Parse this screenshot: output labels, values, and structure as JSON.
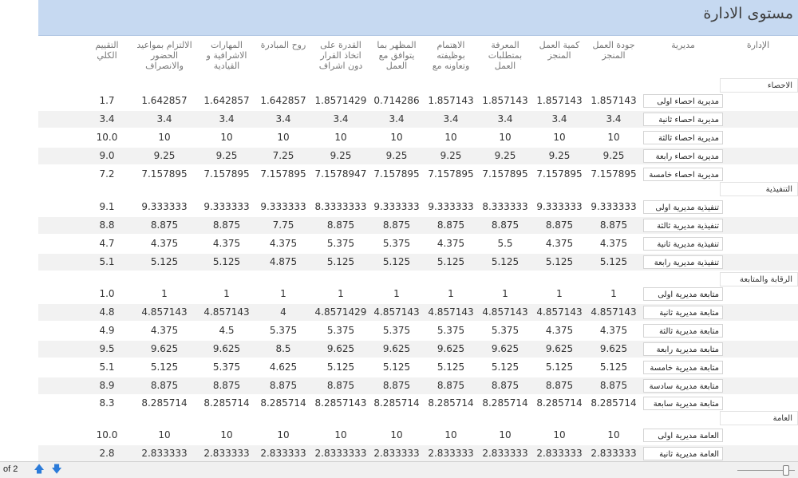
{
  "report": {
    "title": "مستوى الادارة",
    "headers": {
      "admin": "الإدارة",
      "directorate": "مديرية",
      "c1": "جودة العمل المنجز",
      "c2": "كمية العمل المنجز",
      "c3": "المعرفة بمتطلبات العمل",
      "c4": "الاهتمام بوظيفته وتعاونه مع",
      "c5": "المظهر بما يتوافق مع العمل",
      "c6": "القدرة على اتخاذ القرار دون اشراف",
      "c7": "روح المبادرة",
      "c8": "المهارات الاشرافية و القيادية",
      "c9": "الالتزام بمواعيد الحضور والانصراف",
      "c10": "التقييم الكلي"
    },
    "groups": [
      {
        "label": "الاحصاء",
        "rows": [
          {
            "name": "مديرية احصاء اولى",
            "vals": [
              "1.857143",
              "1.857143",
              "1.857143",
              "1.857143",
              "0.714286",
              "1.8571429",
              "1.642857",
              "1.642857",
              "1.642857",
              "1.7"
            ]
          },
          {
            "name": "مديرية احصاء ثانية",
            "vals": [
              "3.4",
              "3.4",
              "3.4",
              "3.4",
              "3.4",
              "3.4",
              "3.4",
              "3.4",
              "3.4",
              "3.4"
            ]
          },
          {
            "name": "مديرية احصاء ثالثة",
            "vals": [
              "10",
              "10",
              "10",
              "10",
              "10",
              "10",
              "10",
              "10",
              "10",
              "10.0"
            ]
          },
          {
            "name": "مديرية احصاء رابعة",
            "vals": [
              "9.25",
              "9.25",
              "9.25",
              "9.25",
              "9.25",
              "9.25",
              "7.25",
              "9.25",
              "9.25",
              "9.0"
            ]
          },
          {
            "name": "مديرية احصاء خامسة",
            "vals": [
              "7.157895",
              "7.157895",
              "7.157895",
              "7.157895",
              "7.157895",
              "7.1578947",
              "7.157895",
              "7.157895",
              "7.157895",
              "7.2"
            ]
          }
        ]
      },
      {
        "label": "التنفيذية",
        "rows": [
          {
            "name": "تنفيذية مديرية اولى",
            "vals": [
              "9.333333",
              "9.333333",
              "8.333333",
              "9.333333",
              "9.333333",
              "8.3333333",
              "9.333333",
              "9.333333",
              "9.333333",
              "9.1"
            ]
          },
          {
            "name": "تنفيذية مديرية ثالثة",
            "vals": [
              "8.875",
              "8.875",
              "8.875",
              "8.875",
              "8.875",
              "8.875",
              "7.75",
              "8.875",
              "8.875",
              "8.8"
            ]
          },
          {
            "name": "تنفيذية مديرية ثانية",
            "vals": [
              "4.375",
              "4.375",
              "5.5",
              "4.375",
              "5.375",
              "5.375",
              "4.375",
              "4.375",
              "4.375",
              "4.7"
            ]
          },
          {
            "name": "تنفيذية مديرية رابعة",
            "vals": [
              "5.125",
              "5.125",
              "5.125",
              "5.125",
              "5.125",
              "5.125",
              "4.875",
              "5.125",
              "5.125",
              "5.1"
            ]
          }
        ]
      },
      {
        "label": "الرقابة والمتابعة",
        "rows": [
          {
            "name": "متابعة مديرية اولى",
            "vals": [
              "1",
              "1",
              "1",
              "1",
              "1",
              "1",
              "1",
              "1",
              "1",
              "1.0"
            ]
          },
          {
            "name": "متابعة مديرية ثانية",
            "vals": [
              "4.857143",
              "4.857143",
              "4.857143",
              "4.857143",
              "4.857143",
              "4.8571429",
              "4",
              "4.857143",
              "4.857143",
              "4.8"
            ]
          },
          {
            "name": "متابعة مديرية ثالثة",
            "vals": [
              "4.375",
              "4.375",
              "5.375",
              "5.375",
              "5.375",
              "5.375",
              "5.375",
              "4.5",
              "4.375",
              "4.9"
            ]
          },
          {
            "name": "متابعة مديرية رابعة",
            "vals": [
              "9.625",
              "9.625",
              "9.625",
              "9.625",
              "9.625",
              "9.625",
              "8.5",
              "9.625",
              "9.625",
              "9.5"
            ]
          },
          {
            "name": "متابعة مديرية خامسة",
            "vals": [
              "5.125",
              "5.125",
              "5.125",
              "5.125",
              "5.125",
              "5.125",
              "4.625",
              "5.375",
              "5.125",
              "5.1"
            ]
          },
          {
            "name": "متابعة مديرية سادسة",
            "vals": [
              "8.875",
              "8.875",
              "8.875",
              "8.875",
              "8.875",
              "8.875",
              "8.875",
              "8.875",
              "8.875",
              "8.9"
            ]
          },
          {
            "name": "متابعة مديرية سابعة",
            "vals": [
              "8.285714",
              "8.285714",
              "8.285714",
              "8.285714",
              "8.285714",
              "8.2857143",
              "8.285714",
              "8.285714",
              "8.285714",
              "8.3"
            ]
          }
        ]
      },
      {
        "label": "العامة",
        "rows": [
          {
            "name": "العامة مديرية اولى",
            "vals": [
              "10",
              "10",
              "10",
              "10",
              "10",
              "10",
              "10",
              "10",
              "10",
              "10.0"
            ]
          },
          {
            "name": "العامة مديرية ثانية",
            "vals": [
              "2.833333",
              "2.833333",
              "2.833333",
              "2.833333",
              "2.833333",
              "2.8333333",
              "2.833333",
              "2.833333",
              "2.833333",
              "2.8"
            ]
          }
        ]
      }
    ]
  },
  "statusbar": {
    "page_of": "of 2",
    "prev_icon": "up-arrow-icon",
    "next_icon": "down-arrow-icon"
  },
  "colors": {
    "title_band": "#c6d9f1",
    "shade_row": "#f2f2f2",
    "nav_arrow": "#2b7bd9"
  }
}
